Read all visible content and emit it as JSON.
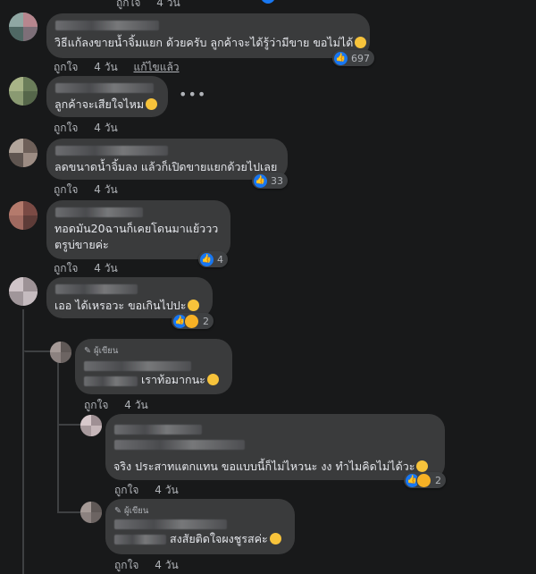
{
  "actions": {
    "like": "ถูกใจ",
    "reply_time": "4 วัน",
    "edited": "แก้ไขแล้ว",
    "author_badge": "ผู้เขียน"
  },
  "comments": [
    {
      "text": "วิธีแก้ลงขายน้ำจิ้มแยก ด้วยครับ ลูกค้าจะได้รู้ว่ามีขาย ขอไม่ได้",
      "reaction_count": "697",
      "reaction_types": [
        "like"
      ]
    },
    {
      "text": "ลูกค้าจะเสียใจไหม",
      "reaction_count": "",
      "reaction_types": []
    },
    {
      "text": "ลดขนาดน้ำจิ้มลง แล้วก็เปิดขายแยกด้วยไปเลย",
      "reaction_count": "33",
      "reaction_types": [
        "like"
      ]
    },
    {
      "text_line1": "ทอดมัน20ฉานก็เคยโดนมาแย้ววว",
      "text_line2": "ตรูบ่ขายค่ะ",
      "reaction_count": "4",
      "reaction_types": [
        "like"
      ]
    },
    {
      "text": "เออ ได้เหรอวะ ขอเกินไปปะ",
      "reaction_count": "2",
      "reaction_types": [
        "like",
        "haha"
      ]
    }
  ],
  "replies": [
    {
      "text": "เราท้อมากนะ",
      "author": true,
      "reaction_count": ""
    },
    {
      "text": "จริง ประสาทแตกแทน ขอแบบนี้ก็ไม่ไหวนะ งง ทำไมคิดไม่ได้วะ",
      "author": false,
      "reaction_count": "2",
      "reaction_types": [
        "like",
        "haha"
      ]
    },
    {
      "text": "สงสัยติดใจผงชูรสค่ะ",
      "author": true,
      "reaction_count": ""
    }
  ],
  "icons": {
    "pencil": "pencil-icon",
    "more": "more-options-icon",
    "like": "like-icon",
    "haha": "haha-icon"
  },
  "colors": {
    "background": "#18191a",
    "bubble": "#3a3b3c",
    "meta_text": "#b0b3b8",
    "like_blue": "#1877f2"
  }
}
